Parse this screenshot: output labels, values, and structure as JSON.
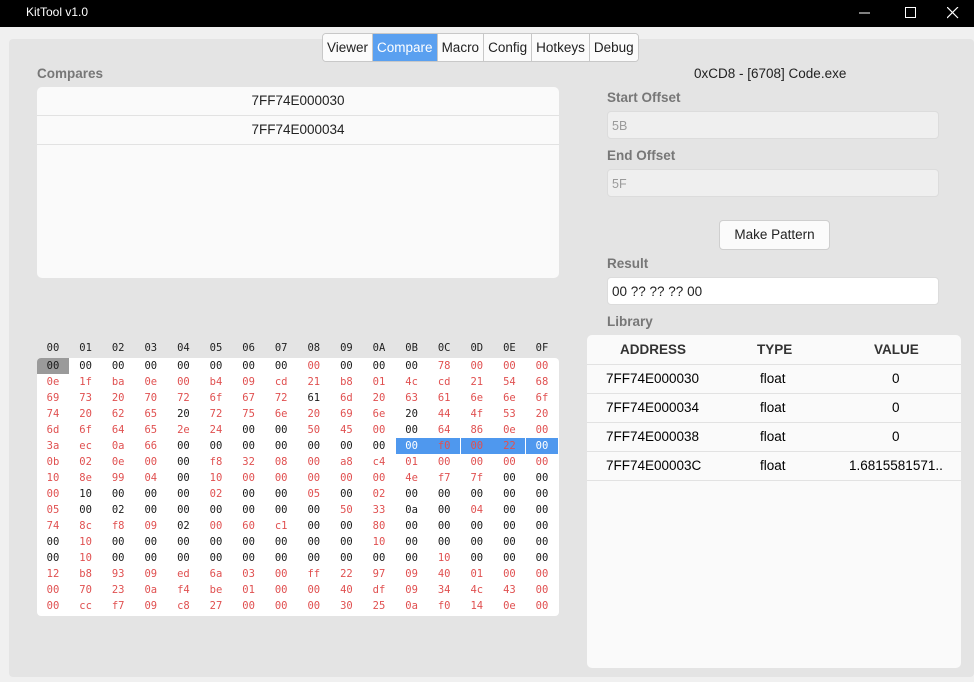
{
  "window": {
    "title": "KitTool v1.0"
  },
  "tabs": [
    {
      "label": "Viewer",
      "active": false
    },
    {
      "label": "Compare",
      "active": true
    },
    {
      "label": "Macro",
      "active": false
    },
    {
      "label": "Config",
      "active": false
    },
    {
      "label": "Hotkeys",
      "active": false
    },
    {
      "label": "Debug",
      "active": false
    }
  ],
  "compares": {
    "label": "Compares",
    "items": [
      "7FF74E000030",
      "7FF74E000034"
    ]
  },
  "process": {
    "title": "0xCD8 - [6708] Code.exe"
  },
  "start_offset": {
    "label": "Start Offset",
    "placeholder": "5B"
  },
  "end_offset": {
    "label": "End Offset",
    "placeholder": "5F"
  },
  "make_pattern": {
    "label": "Make Pattern"
  },
  "result": {
    "label": "Result",
    "value": "00 ?? ?? ?? 00"
  },
  "library": {
    "label": "Library",
    "headers": [
      "ADDRESS",
      "TYPE",
      "VALUE"
    ],
    "rows": [
      [
        "7FF74E000030",
        "float",
        "0"
      ],
      [
        "7FF74E000034",
        "float",
        "0"
      ],
      [
        "7FF74E000038",
        "float",
        "0"
      ],
      [
        "7FF74E00003C",
        "float",
        "1.6815581571.."
      ]
    ]
  },
  "hex": {
    "columns": [
      "00",
      "01",
      "02",
      "03",
      "04",
      "05",
      "06",
      "07",
      "08",
      "09",
      "0A",
      "0B",
      "0C",
      "0D",
      "0E",
      "0F"
    ],
    "rows": [
      "00 00 00 00 00 00 00 00 00 00 00 00 78 00 00 00",
      "0e 1f ba 0e 00 b4 09 cd 21 b8 01 4c cd 21 54 68",
      "69 73 20 70 72 6f 67 72 61 6d 20 63 61 6e 6e 6f",
      "74 20 62 65 20 72 75 6e 20 69 6e 20 44 4f 53 20",
      "6d 6f 64 65 2e 24 00 00 50 45 00 00 64 86 0e 00",
      "3a ec 0a 66 00 00 00 00 00 00 00 00 f0 00 22 00",
      "0b 02 0e 00 00 f8 32 08 00 a8 c4 01 00 00 00 00",
      "10 8e 99 04 00 10 00 00 00 00 00 4e f7 7f 00 00",
      "00 10 00 00 00 02 00 00 05 00 02 00 00 00 00 00",
      "05 00 02 00 00 00 00 00 00 50 33 0a 00 04 00 00",
      "74 8c f8 09 02 00 60 c1 00 00 80 00 00 00 00 00",
      "00 10 00 00 00 00 00 00 00 00 10 00 00 00 00 00",
      "00 10 00 00 00 00 00 00 00 00 00 00 10 00 00 00",
      "12 b8 93 09 ed 6a 03 00 ff 22 97 09 40 01 00 00",
      "00 70 23 0a f4 be 01 00 00 40 df 09 34 4c 43 00",
      "00 cc f7 09 c8 27 00 00 00 30 25 0a f0 14 0e 00"
    ],
    "colors": {
      "changed": "#e05050",
      "same": "#1a1a1a",
      "selection_bg": "#4f98ee",
      "cursor_bg": "#9a9a9a"
    }
  }
}
